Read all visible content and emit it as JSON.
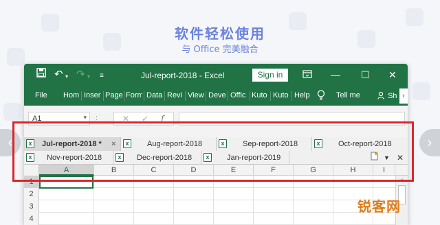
{
  "headline": "软件轻松使用",
  "subheadline": "与 Office 完美融合",
  "watermark": "锐客网",
  "colors": {
    "excel_green": "#217346",
    "highlight_red": "#d9262b",
    "headline_blue": "#6b83dc"
  },
  "titlebar": {
    "save_icon": "save-icon",
    "undo_icon": "undo-icon",
    "redo_icon": "redo-icon",
    "title": "Jul-report-2018  -  Excel",
    "sign_in": "Sign in",
    "window_controls": [
      "ribbon-display-icon",
      "minimize-icon",
      "maximize-icon",
      "close-icon"
    ]
  },
  "menu": {
    "items": [
      "File",
      "Hom",
      "Inser",
      "Page",
      "Form",
      "Data",
      "Revi",
      "View",
      "Deve",
      "Offic",
      "Kuto",
      "Kuto",
      "Help"
    ],
    "tell_me": "Tell me",
    "share": "Sh"
  },
  "formula_bar": {
    "name_box": "A1",
    "dots": ":",
    "cancel": "✕",
    "enter": "✓",
    "fx": "f",
    "value": ""
  },
  "sheet_tabs": {
    "row1": [
      {
        "label": "Jul-report-2018 *",
        "active": true,
        "closable": true
      },
      {
        "label": "Aug-report-2018",
        "active": false
      },
      {
        "label": "Sep-report-2018",
        "active": false
      },
      {
        "label": "Oct-report-2018",
        "active": false
      }
    ],
    "row2": [
      {
        "label": "Nov-report-2018",
        "active": false
      },
      {
        "label": "Dec-report-2018",
        "active": false
      },
      {
        "label": "Jan-report-2019",
        "active": false
      }
    ],
    "close_glyph": "×"
  },
  "grid": {
    "columns": [
      "A",
      "B",
      "C",
      "D",
      "E",
      "F",
      "G",
      "H",
      "I"
    ],
    "rows": [
      "1",
      "2",
      "3",
      "4"
    ],
    "selected_cell": "A1"
  }
}
